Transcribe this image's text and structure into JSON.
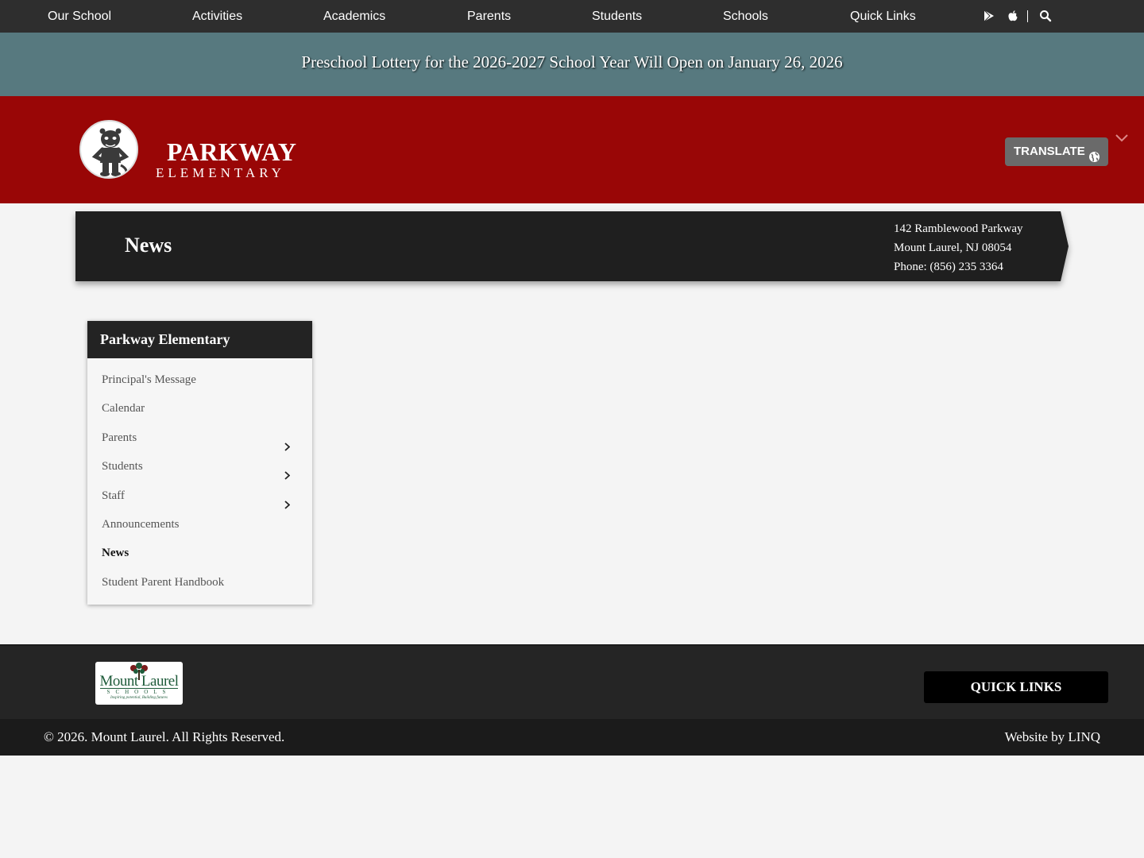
{
  "topnav": {
    "items": [
      "Our School",
      "Activities",
      "Academics",
      "Parents",
      "Students",
      "Schools",
      "Quick Links"
    ],
    "icons": [
      "google-play-icon",
      "apple-icon",
      "search-icon"
    ]
  },
  "alert": {
    "text": "Preschool Lottery for the 2026-2027 School Year Will Open on January 26, 2026"
  },
  "header": {
    "school_name": "PARKWAY",
    "school_sub": "ELEMENTARY",
    "translate_label": "TRANSLATE"
  },
  "page": {
    "title": "News",
    "address_line1": "142 Ramblewood Parkway",
    "address_line2": "Mount Laurel, NJ 08054",
    "phone": "Phone: (856) 235 3364"
  },
  "sidebar": {
    "heading": "Parkway Elementary",
    "items": [
      {
        "label": "Principal's Message"
      },
      {
        "label": "Calendar"
      },
      {
        "label": "Parents"
      },
      {
        "label": "Students"
      },
      {
        "label": "Staff"
      },
      {
        "label": "Announcements"
      },
      {
        "label": "News"
      },
      {
        "label": "Student Parent Handbook"
      }
    ]
  },
  "footer": {
    "logo_text": "Mount Laurel",
    "logo_sub": "SCHOOLS",
    "logo_tag": "Inspiring potential, Building futures",
    "quick_links_label": "QUICK LINKS",
    "copyright": "© 2026. Mount Laurel. All Rights Reserved.",
    "credit": "Website by LINQ"
  },
  "colors": {
    "nav_bg": "#2e2e2e",
    "alert_bg": "#57797f",
    "header_bg": "#990606",
    "title_bar_bg": "#1f1f1f",
    "footer_bg": "#252525"
  }
}
